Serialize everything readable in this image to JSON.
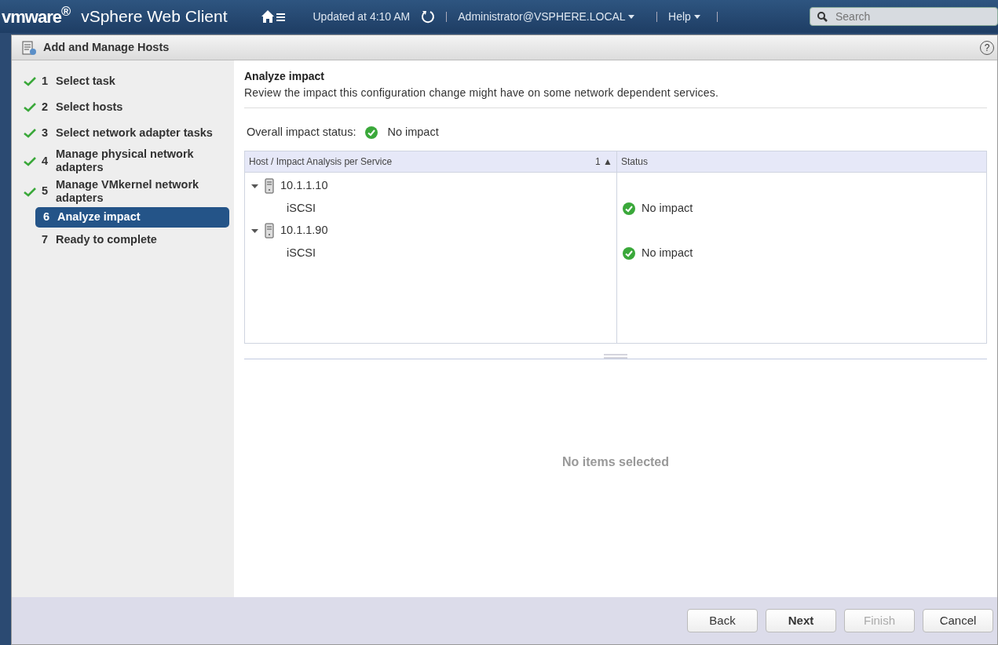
{
  "top_bar": {
    "brand": "vmware$^{®}$",
    "product": "vSphere Web Client",
    "updated": "Updated at 4:10 AM",
    "user": "Administrator@VSPHERE.LOCAL",
    "help": "Help",
    "search": {
      "placeholder": "Search"
    }
  },
  "dialog": {
    "title": "Add and Manage Hosts",
    "help_icon": "?",
    "steps": [
      {
        "number": "1",
        "label": "Select task",
        "completed": true,
        "selected": false
      },
      {
        "number": "2",
        "label": "Select hosts",
        "completed": true,
        "selected": false
      },
      {
        "number": "3",
        "label": "Select network adapter tasks",
        "completed": true,
        "selected": false
      },
      {
        "number": "4",
        "label": "Manage physical network adapters",
        "completed": true,
        "selected": false
      },
      {
        "number": "5",
        "label": "Manage VMkernel network adapters",
        "completed": true,
        "selected": false
      },
      {
        "number": "6",
        "label": "Analyze impact",
        "completed": false,
        "selected": true
      },
      {
        "number": "7",
        "label": "Ready to complete",
        "completed": false,
        "selected": false
      }
    ],
    "heading": "Analyze impact",
    "description": "Review the impact this configuration change might have on some network dependent services.",
    "overall_label": "Overall impact status:",
    "overall_status": "No impact",
    "table": {
      "columns": [
        {
          "label": "Host / Impact Analysis per Service",
          "sort": "1 ▲"
        },
        {
          "label": "Status"
        }
      ],
      "rows": [
        {
          "host": "10.1.1.10",
          "expanded": true,
          "children": [
            {
              "service": "iSCSI",
              "status": "No impact"
            }
          ]
        },
        {
          "host": "10.1.1.90",
          "expanded": true,
          "children": [
            {
              "service": "iSCSI",
              "status": "No impact"
            }
          ]
        }
      ]
    },
    "details_empty": "No items selected",
    "buttons": [
      {
        "label": "Back",
        "primary": false,
        "disabled": false
      },
      {
        "label": "Next",
        "primary": true,
        "disabled": false
      },
      {
        "label": "Finish",
        "primary": false,
        "disabled": true
      },
      {
        "label": "Cancel",
        "primary": false,
        "disabled": false
      }
    ]
  }
}
